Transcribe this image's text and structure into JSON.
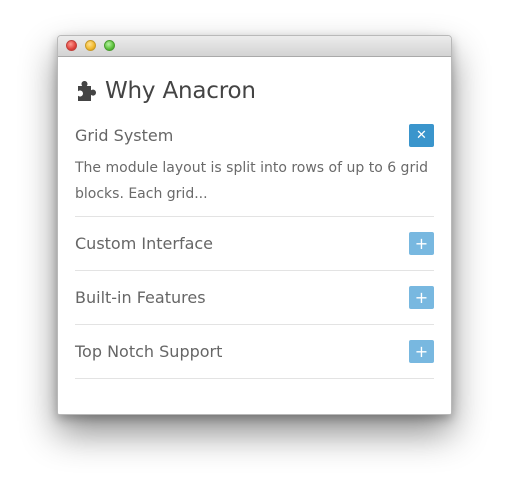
{
  "window": {
    "title": ""
  },
  "page": {
    "title": "Why Anacron",
    "title_icon": "puzzle-piece-icon"
  },
  "accordion": {
    "items": [
      {
        "label": "Grid System",
        "expanded": true,
        "toggle_symbol": "✕",
        "body": "The module layout is split into rows of up to 6 grid blocks. Each grid..."
      },
      {
        "label": "Custom Interface",
        "expanded": false,
        "toggle_symbol": "+"
      },
      {
        "label": "Built-in Features",
        "expanded": false,
        "toggle_symbol": "+"
      },
      {
        "label": "Top Notch Support",
        "expanded": false,
        "toggle_symbol": "+"
      }
    ]
  },
  "colors": {
    "toggle_active": "#3a95cc",
    "toggle_inactive": "#78b8e0",
    "text_primary": "#444444",
    "text_secondary": "#666666"
  }
}
